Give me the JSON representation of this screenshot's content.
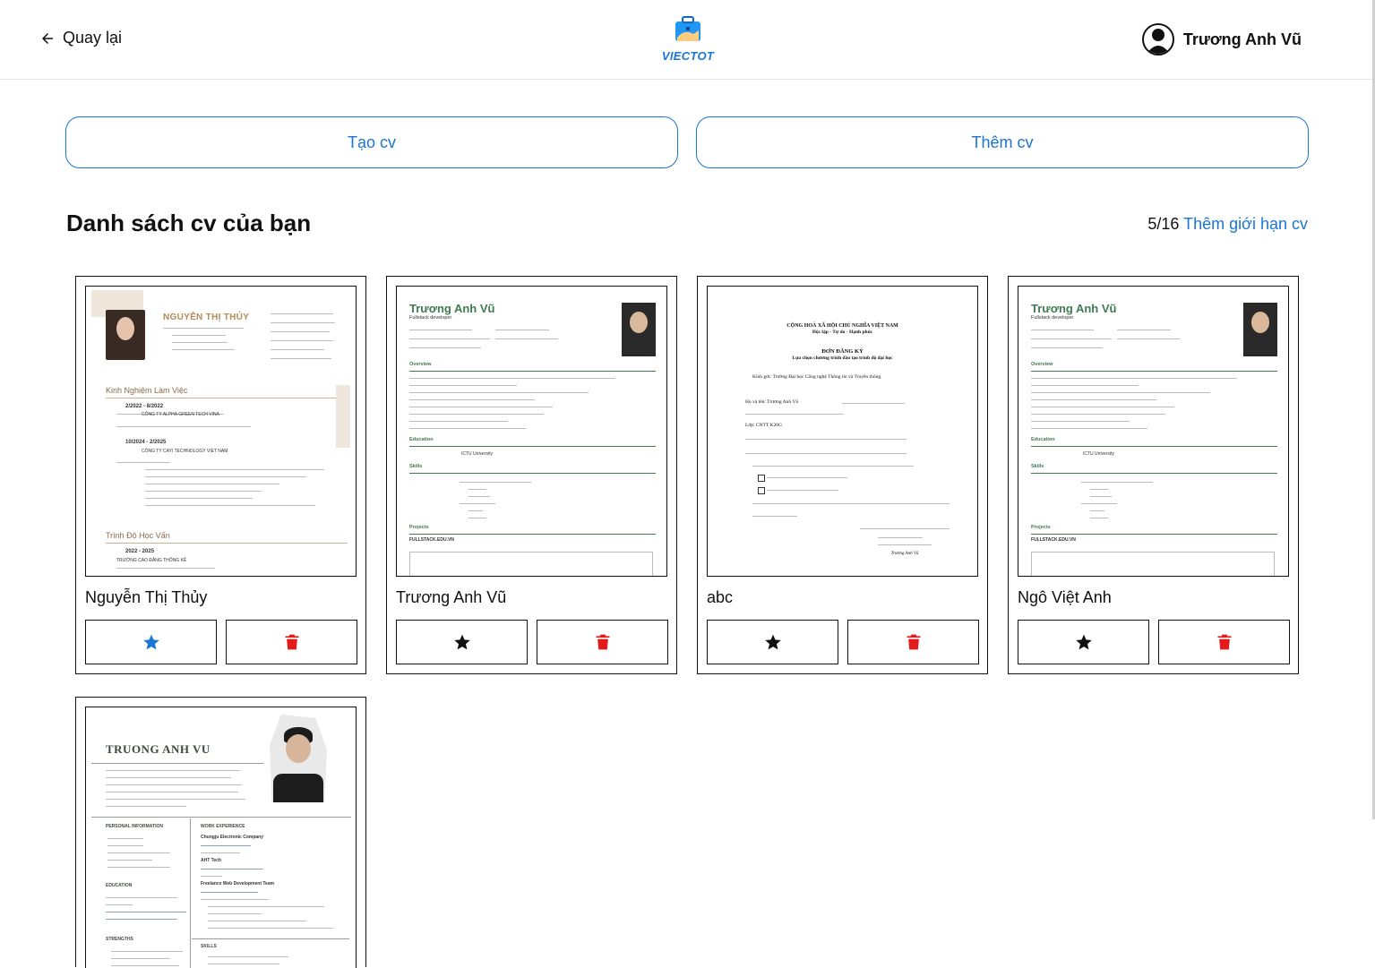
{
  "header": {
    "back_label": "Quay lại",
    "logo_text": "VIECTOT",
    "user_name": "Trương Anh Vũ"
  },
  "actions": {
    "create_label": "Tạo cv",
    "add_label": "Thêm cv"
  },
  "list": {
    "title": "Danh sách cv của bạn",
    "count": "5/16",
    "limit_link": "Thêm giới hạn cv"
  },
  "colors": {
    "accent": "#1976d2",
    "delete": "#e31b1b",
    "star_default": "#111111",
    "star_active": "#1976d2"
  },
  "cvs": [
    {
      "name": "Nguyễn Thị Thủy",
      "starred": true,
      "template": "cv-1",
      "preview": {
        "name": "NGUYỄN THỊ THỦY",
        "section1": "Kinh Nghiệm Làm Việc",
        "section2": "Trình Độ Học Vấn",
        "date1": "2/2022 - 8/2022",
        "company1": "CÔNG TY ALPHA GREEN TECH VINA",
        "date2": "10/2024 - 2/2025",
        "company2": "CÔNG TY CAYI TECHNOLOGY VIET NAM",
        "date3": "2022 - 2025",
        "school": "TRƯỜNG CAO ĐẲNG THỐNG KÊ"
      }
    },
    {
      "name": "Trương Anh Vũ",
      "starred": false,
      "template": "cv-2",
      "preview": {
        "name": "Trương Anh Vũ",
        "role": "Fullstack developer",
        "overview": "Overview",
        "education": "Education",
        "skills": "Skills",
        "projects": "Projects",
        "school": "ICTU University",
        "project": "FULLSTACK.EDU.VN"
      }
    },
    {
      "name": "abc",
      "starred": false,
      "template": "cv-3",
      "preview": {
        "header1": "CỘNG HOÀ XÃ HỘI CHỦ NGHĨA VIỆT NAM",
        "header2": "Độc lập - Tự do - Hạnh phúc",
        "title": "ĐƠN ĐĂNG KÝ",
        "subtitle": "Lựa chọn chương trình đào tạo trình độ đại học",
        "to": "Kính gửi: Trường Đại học Công nghệ Thông tin và Truyền thông.",
        "line1": "Họ và tên: Trương Anh Vũ",
        "line2": "Lớp: CNTT K20G",
        "signer": "Trương Anh Vũ"
      }
    },
    {
      "name": "Ngô Việt Anh",
      "starred": false,
      "template": "cv-2",
      "preview": {
        "name": "Trương Anh Vũ",
        "role": "Fullstack developer",
        "overview": "Overview",
        "education": "Education",
        "skills": "Skills",
        "projects": "Projects",
        "school": "ICTU University",
        "project": "FULLSTACK.EDU.VN"
      }
    },
    {
      "name": "",
      "starred": false,
      "template": "cv-4",
      "preview": {
        "name": "TRUONG ANH VU",
        "personal": "PERSONAL INFORMATION",
        "education": "EDUCATION",
        "strengths": "STRENGTHS",
        "work": "WORK EXPERIENCE",
        "skills": "SKILLS",
        "company1": "Chungju Electronic Company",
        "company2": "AHT Tech",
        "company3": "Freelance Web Development Team"
      }
    }
  ]
}
